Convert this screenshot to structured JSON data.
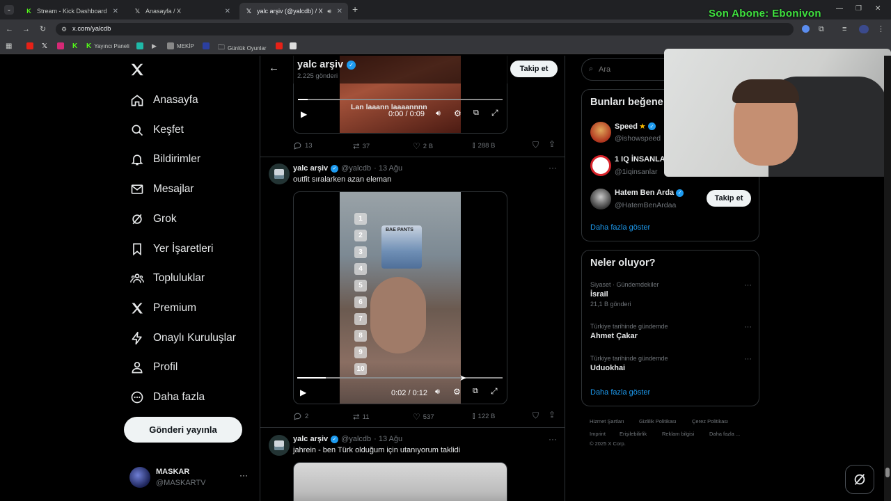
{
  "overlay": {
    "text": "Son Abone: Ebonivon",
    "color": "#3fe23f"
  },
  "browser": {
    "tabs": [
      {
        "title": "Stream - Kick Dashboard",
        "icon": "kick-icon"
      },
      {
        "title": "Anasayfa / X",
        "icon": "x-icon"
      },
      {
        "title": "yalc arşiv (@yalcdb) / X",
        "icon": "x-icon"
      }
    ],
    "new_tab": "+",
    "url": "x.com/yalcdb",
    "bookmarks": [
      {
        "label": "",
        "icon": "youtube-icon"
      },
      {
        "label": "",
        "icon": "x-icon"
      },
      {
        "label": "",
        "icon": "instagram-icon"
      },
      {
        "label": "",
        "icon": "kick-icon"
      },
      {
        "label": "Yayıncı Paneli",
        "icon": "kick-icon"
      },
      {
        "label": "",
        "icon": "app-icon"
      },
      {
        "label": "",
        "icon": "play-icon"
      },
      {
        "label": "MEKİP",
        "icon": "page-icon"
      },
      {
        "label": "",
        "icon": "calendar-icon"
      },
      {
        "label": "Günlük Oyunlar",
        "icon": "folder-icon"
      },
      {
        "label": "",
        "icon": "youtube-icon"
      },
      {
        "label": "",
        "icon": "image-icon"
      }
    ]
  },
  "nav": {
    "items": [
      {
        "label": "Anasayfa",
        "icon": "home-icon"
      },
      {
        "label": "Keşfet",
        "icon": "search-icon"
      },
      {
        "label": "Bildirimler",
        "icon": "bell-icon"
      },
      {
        "label": "Mesajlar",
        "icon": "mail-icon"
      },
      {
        "label": "Grok",
        "icon": "grok-icon"
      },
      {
        "label": "Yer İşaretleri",
        "icon": "bookmark-icon"
      },
      {
        "label": "Topluluklar",
        "icon": "communities-icon"
      },
      {
        "label": "Premium",
        "icon": "x-icon"
      },
      {
        "label": "Onaylı Kuruluşlar",
        "icon": "lightning-icon"
      },
      {
        "label": "Profil",
        "icon": "profile-icon"
      },
      {
        "label": "Daha fazla",
        "icon": "more-circle-icon"
      }
    ],
    "post_button": "Gönderi yayınla",
    "account": {
      "name": "MASKAR",
      "handle": "@MASKARTV",
      "more": "···"
    }
  },
  "profile_header": {
    "name": "yalc arşiv",
    "posts": "2.225 gönderi",
    "follow": "Takip et"
  },
  "tweets": [
    {
      "caption": "Lan laaann laaaannnn",
      "time": "0:00 / 0:09",
      "stats": {
        "replies": "13",
        "reposts": "37",
        "likes": "2 B",
        "views": "288 B"
      }
    },
    {
      "name": "yalc arşiv",
      "handle": "@yalcdb",
      "date": "· 13 Ağu",
      "text": "outfit sıralarken azan eleman",
      "more": "···",
      "video_overlay_text": "BAE PANTS",
      "numbers": [
        "1",
        "2",
        "3",
        "4",
        "5",
        "6",
        "7",
        "8",
        "9",
        "10"
      ],
      "time": "0:02 / 0:12",
      "progress": 0.14,
      "stats": {
        "replies": "2",
        "reposts": "11",
        "likes": "537",
        "views": "122 B"
      }
    },
    {
      "name": "yalc arşiv",
      "handle": "@yalcdb",
      "date": "· 13 Ağu",
      "text": "jahrein - ben Türk olduğum için utanıyorum taklidi",
      "more": "···"
    }
  ],
  "search": {
    "placeholder": "Ara"
  },
  "who_to_follow": {
    "title": "Bunları beğene",
    "accounts": [
      {
        "name": "Speed",
        "handle": "@ishowspeed"
      },
      {
        "name": "1 IQ İNSANLA",
        "handle": "@1iqinsanlar"
      },
      {
        "name": "Hatem Ben Arda",
        "handle": "@HatemBenArdaa",
        "follow": "Takip et"
      }
    ],
    "show_more": "Daha fazla göster"
  },
  "trends": {
    "title": "Neler oluyor?",
    "items": [
      {
        "context": "Siyaset · Gündemdekiler",
        "name": "İsrail",
        "count": "21,1 B gönderi"
      },
      {
        "context": "Türkiye tarihinde gündemde",
        "name": "Ahmet Çakar",
        "count": ""
      },
      {
        "context": "Türkiye tarihinde gündemde",
        "name": "Uduokhai",
        "count": ""
      }
    ],
    "show_more": "Daha fazla göster"
  },
  "footer": {
    "links": [
      "Hizmet Şartları",
      "Gizlilik Politikası",
      "Çerez Politikası",
      "Imprint",
      "Erişilebilirlik",
      "Reklam bilgisi",
      "Daha fazla ..."
    ],
    "copyright": "© 2025 X Corp."
  },
  "colors": {
    "accent": "#1d9bf0",
    "verified": "#1d9bf0",
    "kick": "#53fc18"
  }
}
